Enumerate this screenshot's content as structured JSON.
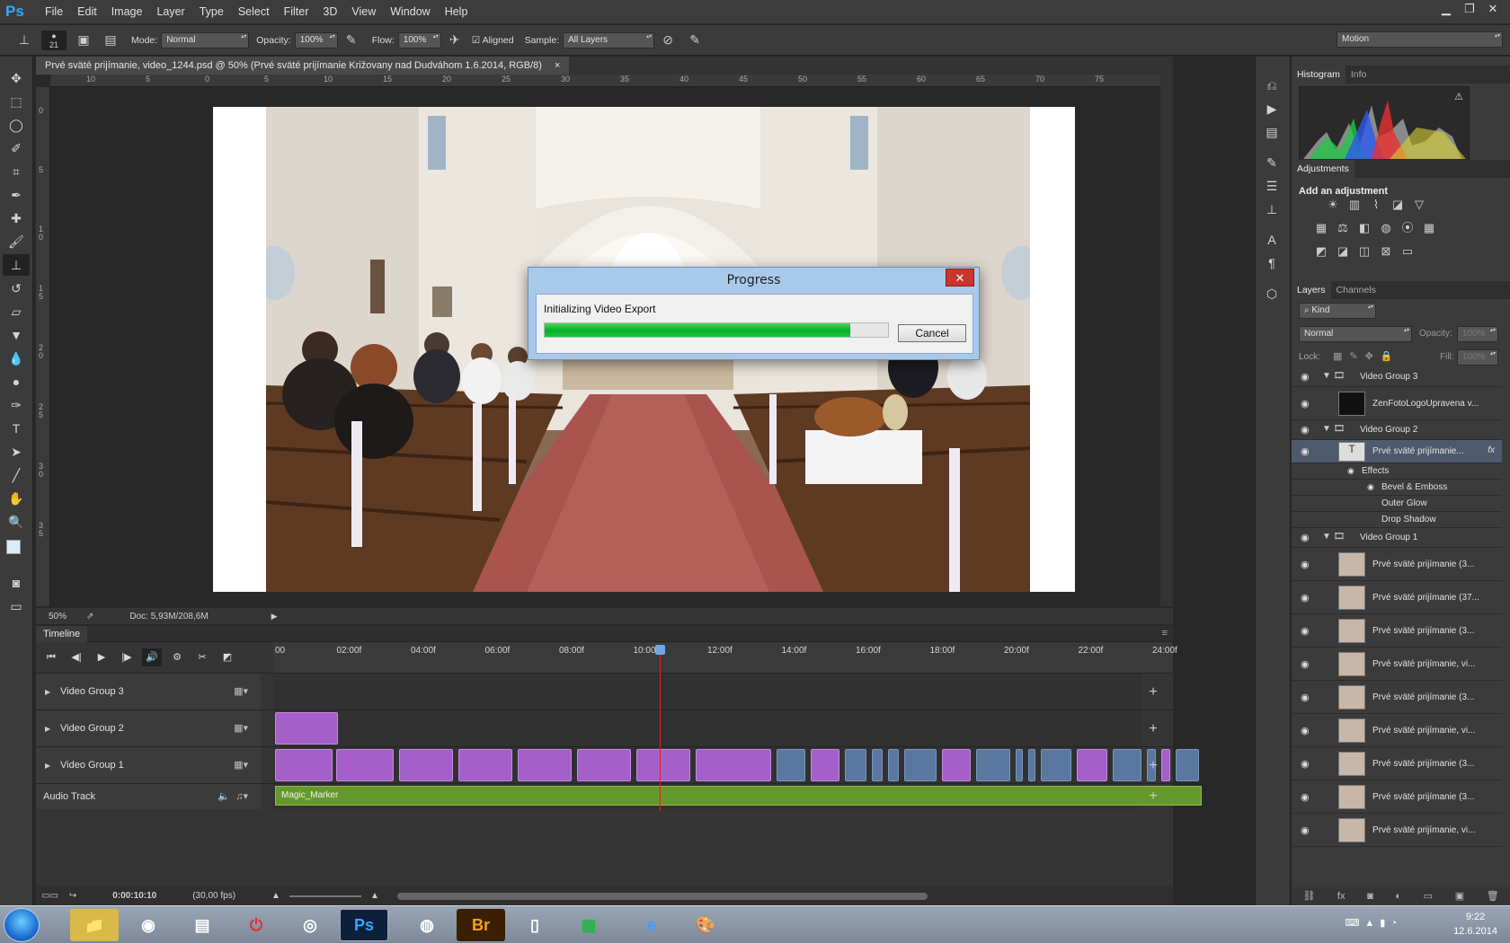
{
  "app": {
    "logo": "Ps"
  },
  "menu": [
    "File",
    "Edit",
    "Image",
    "Layer",
    "Type",
    "Select",
    "Filter",
    "3D",
    "View",
    "Window",
    "Help"
  ],
  "options": {
    "brush_size": "21",
    "mode_label": "Mode:",
    "mode_value": "Normal",
    "opacity_label": "Opacity:",
    "opacity_value": "100%",
    "flow_label": "Flow:",
    "flow_value": "100%",
    "aligned_label": "Aligned",
    "sample_label": "Sample:",
    "sample_value": "All Layers",
    "workspace": "Motion"
  },
  "document": {
    "tab_title": "Prvé sväté prijímanie, video_1244.psd @ 50% (Prvé sväté prijímanie Križovany nad Dudváhom 1.6.2014, RGB/8)",
    "zoom": "50%",
    "doc_info": "Doc: 5,93M/208,6M",
    "ruler_h": [
      "10",
      "5",
      "0",
      "5",
      "10",
      "15",
      "20",
      "25",
      "30",
      "35",
      "40",
      "45",
      "50",
      "55",
      "60",
      "65",
      "70",
      "75"
    ],
    "ruler_v": [
      "0",
      "5",
      "1 0",
      "1 5",
      "2 0",
      "2 5",
      "3 0",
      "3 5"
    ]
  },
  "dialog": {
    "title": "Progress",
    "message": "Initializing Video Export",
    "progress": 0.89,
    "cancel_label": "Cancel"
  },
  "timeline": {
    "panel_title": "Timeline",
    "ticks": [
      "00",
      "02:00f",
      "04:00f",
      "06:00f",
      "08:00f",
      "10:00f",
      "12:00f",
      "14:00f",
      "16:00f",
      "18:00f",
      "20:00f",
      "22:00f",
      "24:00f"
    ],
    "tracks": [
      "Video Group 3",
      "Video Group 2",
      "Video Group 1",
      "Audio Track"
    ],
    "audio_clip": "Magic_Marker",
    "current_time": "0:00:10:10",
    "fps": "(30,00 fps)"
  },
  "panels": {
    "histogram_tab": "Histogram",
    "info_tab": "Info",
    "adjustments_tab": "Adjustments",
    "add_adjustment": "Add an adjustment",
    "layers_tab": "Layers",
    "channels_tab": "Channels",
    "kind": "Kind",
    "blend_mode": "Normal",
    "opacity_label": "Opacity:",
    "opacity_value": "100%",
    "lock_label": "Lock:",
    "fill_label": "Fill:",
    "fill_value": "100%"
  },
  "layers": [
    {
      "name": "Video Group 3",
      "type": "group"
    },
    {
      "name": "ZenFotoLogoUpravena v...",
      "type": "layer"
    },
    {
      "name": "Video Group 2",
      "type": "group"
    },
    {
      "name": "Prvé sväté prijímanie...",
      "type": "text"
    },
    {
      "name": "Effects",
      "type": "effect"
    },
    {
      "name": "Bevel & Emboss",
      "type": "effect"
    },
    {
      "name": "Outer Glow",
      "type": "effect"
    },
    {
      "name": "Drop Shadow",
      "type": "effect"
    },
    {
      "name": "Video Group 1",
      "type": "group"
    },
    {
      "name": "Prvé sväté prijímanie (3...",
      "type": "layer"
    },
    {
      "name": "Prvé sväté prijímanie (37...",
      "type": "layer"
    },
    {
      "name": "Prvé sväté prijímanie (3...",
      "type": "layer"
    },
    {
      "name": "Prvé sväté prijímanie, vi...",
      "type": "layer"
    },
    {
      "name": "Prvé sväté prijímanie (3...",
      "type": "layer"
    },
    {
      "name": "Prvé sväté prijímanie, vi...",
      "type": "layer"
    },
    {
      "name": "Prvé sväté prijímanie (3...",
      "type": "layer"
    },
    {
      "name": "Prvé sväté prijímanie (3...",
      "type": "layer"
    },
    {
      "name": "Prvé sväté prijímanie, vi...",
      "type": "layer"
    }
  ],
  "taskbar": {
    "time": "9:22",
    "date": "12.6.2014",
    "br_label": "Br",
    "ps_label": "Ps"
  }
}
